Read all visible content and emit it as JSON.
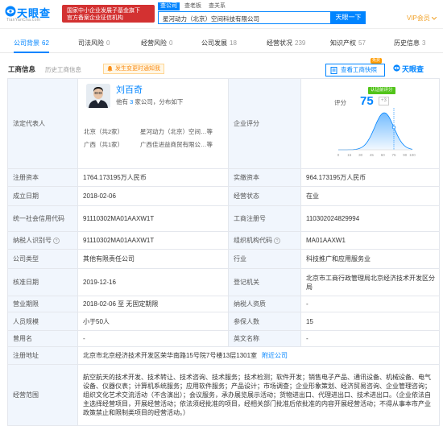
{
  "header": {
    "logo_text": "天眼查",
    "logo_sub": "TianYanCha.com",
    "banner_line1": "国家中小企业发展子基金旗下",
    "banner_line2": "官方备案企业征信机构",
    "search_tabs": [
      "查公司",
      "查老板",
      "查关系"
    ],
    "search_value": "星河动力（北京）空间科技有限公司",
    "search_button": "天眼一下",
    "vip": "VIP会员"
  },
  "nav": {
    "tabs": [
      {
        "label": "公司背景",
        "count": "62"
      },
      {
        "label": "司法风险",
        "count": "0"
      },
      {
        "label": "经营风险",
        "count": "0"
      },
      {
        "label": "公司发展",
        "count": "18"
      },
      {
        "label": "经营状况",
        "count": "239"
      },
      {
        "label": "知识产权",
        "count": "57"
      },
      {
        "label": "历史信息",
        "count": "3"
      }
    ]
  },
  "section": {
    "title": "工商信息",
    "history_link": "历史工商信息",
    "notice": "发生变更时通知我",
    "report_button": "查看工商快照",
    "report_badge": "免费",
    "brand": "天眼查"
  },
  "legal_rep": {
    "label": "法定代表人",
    "name": "刘百奇",
    "desc_prefix": "他有",
    "desc_count": "3",
    "desc_suffix": "家公司，分布如下",
    "locs": [
      "北京（共2家）",
      "广西（共1家）"
    ],
    "companies": [
      "星河动力（北京）空间…等",
      "广西佳进益商贸有限公…等"
    ]
  },
  "score": {
    "label": "企业评分",
    "prefix": "评分",
    "value": "75",
    "delta": "+3",
    "verified": "认证前评分"
  },
  "chart_data": {
    "type": "area",
    "x_ticks": [
      "0",
      "15",
      "30",
      "45",
      "60",
      "75",
      "90",
      "100"
    ],
    "marker": 75
  },
  "rows": [
    {
      "k1": "注册资本",
      "v1": "1764.173195万人民币",
      "k2": "实缴资本",
      "v2": "964.173195万人民币"
    },
    {
      "k1": "成立日期",
      "v1": "2018-02-06",
      "k2": "经营状态",
      "v2": "在业"
    },
    {
      "k1": "统一社会信用代码",
      "v1": "91110302MA01AAXW1T",
      "k2": "工商注册号",
      "v2": "110302024829994"
    },
    {
      "k1": "纳税人识别号",
      "v1": "91110302MA01AAXW1T",
      "k2": "组织机构代码",
      "v2": "MA01AAXW1"
    },
    {
      "k1": "公司类型",
      "v1": "其他有限责任公司",
      "k2": "行业",
      "v2": "科技推广和应用服务业"
    },
    {
      "k1": "核准日期",
      "v1": "2019-12-16",
      "k2": "登记机关",
      "v2": "北京市工商行政管理局北京经济技术开发区分局"
    },
    {
      "k1": "营业期限",
      "v1": "2018-02-06 至 无固定期限",
      "k2": "纳税人资质",
      "v2": "-"
    },
    {
      "k1": "人员规模",
      "v1": "小于50人",
      "k2": "参保人数",
      "v2": "15"
    },
    {
      "k1": "曾用名",
      "v1": "-",
      "k2": "英文名称",
      "v2": "-"
    }
  ],
  "address": {
    "label": "注册地址",
    "value": "北京市北京经济技术开发区荣华南路15号院7号楼13层1301室",
    "link": "附近公司"
  },
  "scope": {
    "label": "经营范围",
    "value": "航空航天的技术开发、技术转让、技术咨询、技术服务；技术检测；软件开发；销售电子产品、通讯设备、机械设备、电气设备、仪器仪表；计算机系统服务；应用软件服务；产品设计；市场调查；企业形象策划、经济贸易咨询、企业管理咨询；组织文化艺术交流活动（不含演出）；会议服务，承办展览展示活动；货物进出口、代理进出口、技术进出口。（企业依法自主选择经营项目，开展经营活动；依法须经批准的项目，经相关部门批准后依批准的内容开展经营活动；不得从事本市产业政策禁止和限制类项目的经营活动。）"
  }
}
